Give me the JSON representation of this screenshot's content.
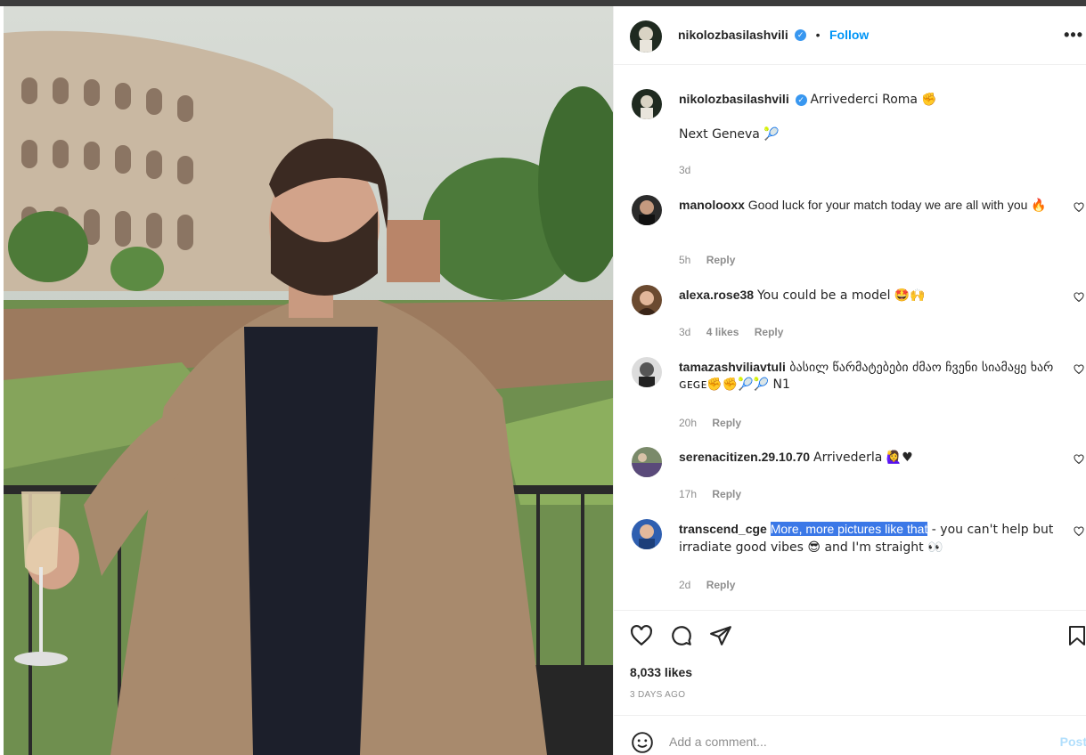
{
  "post": {
    "author": "nikolozbasilashvili",
    "follow_label": "Follow",
    "separator": "•",
    "more_label": "•••",
    "caption": "Arrivederci Roma ✊",
    "caption_line2": "Next Geneva 🎾",
    "caption_time": "3d"
  },
  "comments": [
    {
      "user": "manolooxx",
      "text": "Good luck for your match today we are all with you 🔥",
      "time": "5h",
      "likes": "",
      "reply": "Reply"
    },
    {
      "user": "alexa.rose38",
      "text": "You could be a model 🤩🙌",
      "time": "3d",
      "likes": "4 likes",
      "reply": "Reply"
    },
    {
      "user": "tamazashviliavtuli",
      "text": "ბასილ წარმატებები ძმაო ჩვენი სიამაყე ხარ ɢᴇɢᴇ✊✊🎾🎾 N1",
      "time": "20h",
      "likes": "",
      "reply": "Reply"
    },
    {
      "user": "serenacitizen.29.10.70",
      "text": "Arrivederla 🙋‍♀️♥",
      "time": "17h",
      "likes": "",
      "reply": "Reply"
    },
    {
      "user": "transcend_cge",
      "text_highlight": "More, more pictures like that",
      "text_rest": " - you can't help but irradiate good vibes 😎 and I'm straight 👀",
      "time": "2d",
      "likes": "",
      "reply": "Reply"
    }
  ],
  "stats": {
    "likes": "8,033 likes",
    "posted": "3 DAYS AGO"
  },
  "add_comment": {
    "placeholder": "Add a comment...",
    "post_label": "Post"
  },
  "icons": [
    "heart-icon",
    "comment-icon",
    "share-icon",
    "bookmark-icon",
    "emoji-icon",
    "verified-icon",
    "more-icon"
  ],
  "colors": {
    "accent": "#0095f6",
    "verified": "#3897f0",
    "highlight": "#3b78e7",
    "muted": "#8e8e8e"
  }
}
